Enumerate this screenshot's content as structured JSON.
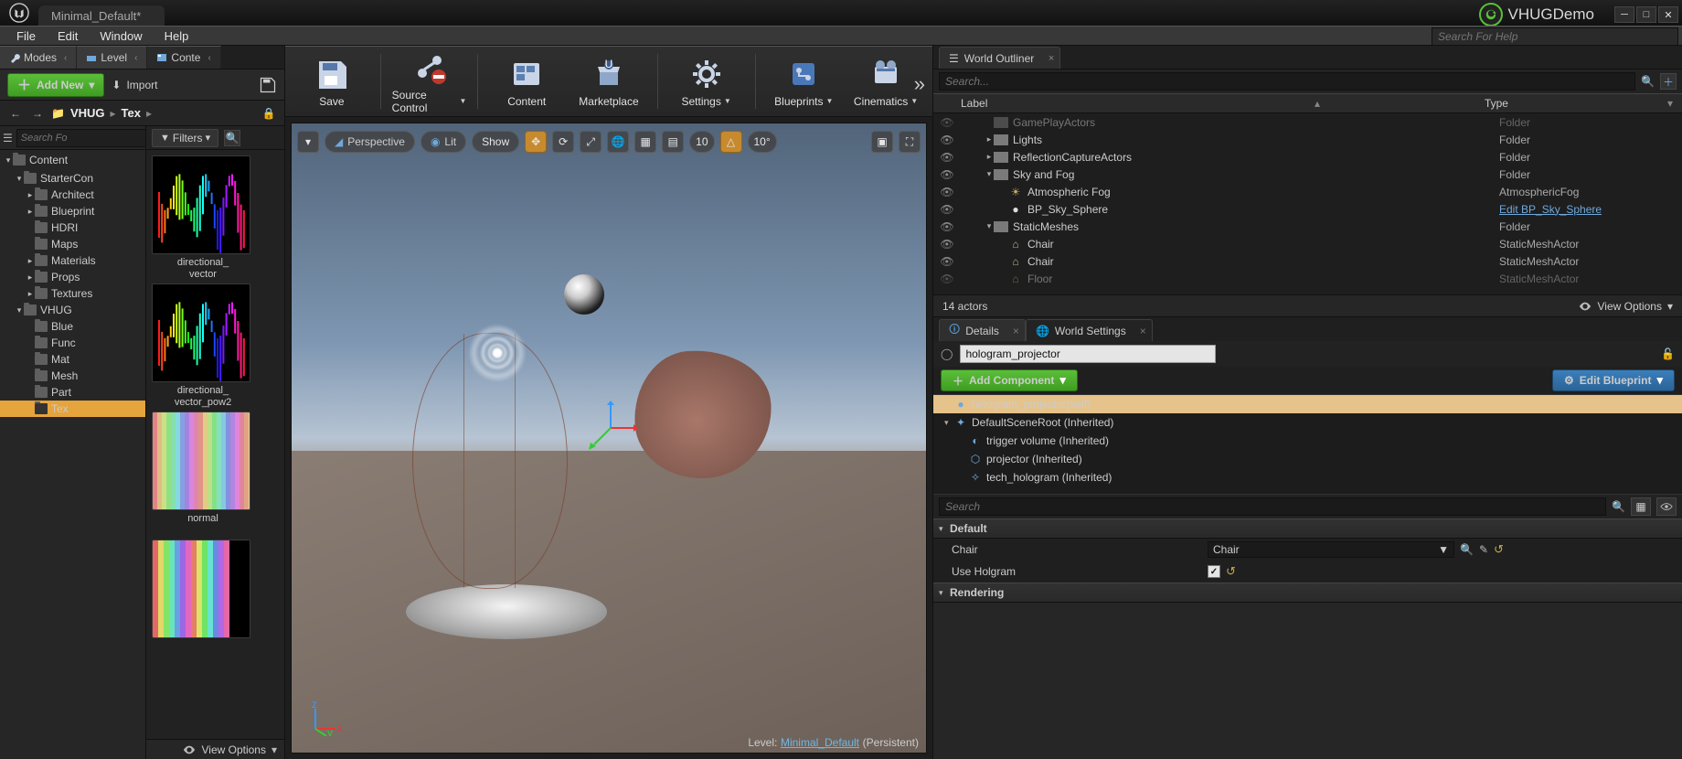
{
  "title": {
    "project_tab": "Minimal_Default*"
  },
  "vhug": {
    "label": "VHUGDemo"
  },
  "help_search_placeholder": "Search For Help",
  "menubar": [
    "File",
    "Edit",
    "Window",
    "Help"
  ],
  "panel_tabs": {
    "modes": "Modes",
    "level": "Level",
    "content": "Conte"
  },
  "content_browser": {
    "add_new": "Add New",
    "import": "Import",
    "path_segments": [
      "VHUG",
      "Tex"
    ],
    "tree_search_placeholder": "Search Fo",
    "filters_label": "Filters",
    "tree": [
      {
        "d": 0,
        "exp": "▾",
        "label": "Content",
        "big": true
      },
      {
        "d": 1,
        "exp": "▾",
        "label": "StarterCon"
      },
      {
        "d": 2,
        "exp": "▸",
        "label": "Architect"
      },
      {
        "d": 2,
        "exp": "▸",
        "label": "Blueprint"
      },
      {
        "d": 2,
        "exp": "",
        "label": "HDRI"
      },
      {
        "d": 2,
        "exp": "",
        "label": "Maps"
      },
      {
        "d": 2,
        "exp": "▸",
        "label": "Materials"
      },
      {
        "d": 2,
        "exp": "▸",
        "label": "Props"
      },
      {
        "d": 2,
        "exp": "▸",
        "label": "Textures"
      },
      {
        "d": 1,
        "exp": "▾",
        "label": "VHUG"
      },
      {
        "d": 2,
        "exp": "",
        "label": "Blue"
      },
      {
        "d": 2,
        "exp": "",
        "label": "Func"
      },
      {
        "d": 2,
        "exp": "",
        "label": "Mat"
      },
      {
        "d": 2,
        "exp": "",
        "label": "Mesh"
      },
      {
        "d": 2,
        "exp": "",
        "label": "Part"
      },
      {
        "d": 2,
        "exp": "",
        "label": "Tex",
        "sel": true
      }
    ],
    "assets": [
      {
        "label": "directional_\nvector",
        "kind": "spectrum"
      },
      {
        "label": "directional_\nvector_pow2",
        "kind": "spectrum"
      },
      {
        "label": "normal",
        "kind": "stripes"
      },
      {
        "label": "",
        "kind": "stripes2"
      }
    ],
    "view_options": "View Options"
  },
  "main_toolbar": [
    {
      "label": "Save",
      "icon": "save"
    },
    {
      "label": "Source Control",
      "icon": "sourcecontrol",
      "dd": true
    },
    {
      "label": "Content",
      "icon": "content"
    },
    {
      "label": "Marketplace",
      "icon": "marketplace"
    },
    {
      "label": "Settings",
      "icon": "settings",
      "dd": true
    },
    {
      "label": "Blueprints",
      "icon": "blueprints",
      "dd": true
    },
    {
      "label": "Cinematics",
      "icon": "cinematics",
      "dd": true
    }
  ],
  "viewport": {
    "perspective": "Perspective",
    "lit": "Lit",
    "show": "Show",
    "snap1": "10",
    "snap2": "10°",
    "level_label": "Level:",
    "level_name": "Minimal_Default",
    "level_suffix": "(Persistent)"
  },
  "outliner": {
    "tab": "World Outliner",
    "search_placeholder": "Search...",
    "col_label": "Label",
    "col_type": "Type",
    "rows": [
      {
        "d": 2,
        "tri": "",
        "icon": "folder",
        "label": "GamePlayActors",
        "type": "Folder",
        "dim": true
      },
      {
        "d": 2,
        "tri": "▸",
        "icon": "folder",
        "label": "Lights",
        "type": "Folder"
      },
      {
        "d": 2,
        "tri": "▸",
        "icon": "folder",
        "label": "ReflectionCaptureActors",
        "type": "Folder"
      },
      {
        "d": 2,
        "tri": "▾",
        "icon": "folder",
        "label": "Sky and Fog",
        "type": "Folder"
      },
      {
        "d": 3,
        "tri": "",
        "icon": "fog",
        "label": "Atmospheric Fog",
        "type": "AtmosphericFog"
      },
      {
        "d": 3,
        "tri": "",
        "icon": "sphere",
        "label": "BP_Sky_Sphere",
        "type": "Edit BP_Sky_Sphere",
        "link": true
      },
      {
        "d": 2,
        "tri": "▾",
        "icon": "folder",
        "label": "StaticMeshes",
        "type": "Folder"
      },
      {
        "d": 3,
        "tri": "",
        "icon": "mesh",
        "label": "Chair",
        "type": "StaticMeshActor"
      },
      {
        "d": 3,
        "tri": "",
        "icon": "mesh",
        "label": "Chair",
        "type": "StaticMeshActor"
      },
      {
        "d": 3,
        "tri": "",
        "icon": "mesh",
        "label": "Floor",
        "type": "StaticMeshActor",
        "dim": true
      }
    ],
    "actor_count": "14 actors",
    "view_options": "View Options"
  },
  "details": {
    "tab_details": "Details",
    "tab_world": "World Settings",
    "actor_name": "hologram_projector",
    "add_component": "Add Component",
    "edit_blueprint": "Edit Blueprint",
    "components": [
      {
        "d": 0,
        "tri": "",
        "icon": "●",
        "label": "hologram_projector(self)",
        "sel": true
      },
      {
        "d": 0,
        "tri": "▾",
        "icon": "✦",
        "label": "DefaultSceneRoot (Inherited)"
      },
      {
        "d": 1,
        "tri": "",
        "icon": "◐",
        "label": "trigger volume (Inherited)"
      },
      {
        "d": 1,
        "tri": "",
        "icon": "⬡",
        "label": "projector (Inherited)"
      },
      {
        "d": 1,
        "tri": "",
        "icon": "✧",
        "label": "tech_hologram (Inherited)"
      }
    ],
    "search_placeholder": "Search",
    "groups": [
      {
        "title": "Default",
        "rows": [
          {
            "label": "Chair",
            "kind": "combo",
            "value": "Chair",
            "reset": true,
            "extras": true
          },
          {
            "label": "Use Holgram",
            "kind": "check",
            "value": true,
            "reset": true
          }
        ]
      },
      {
        "title": "Rendering",
        "rows": []
      }
    ]
  }
}
